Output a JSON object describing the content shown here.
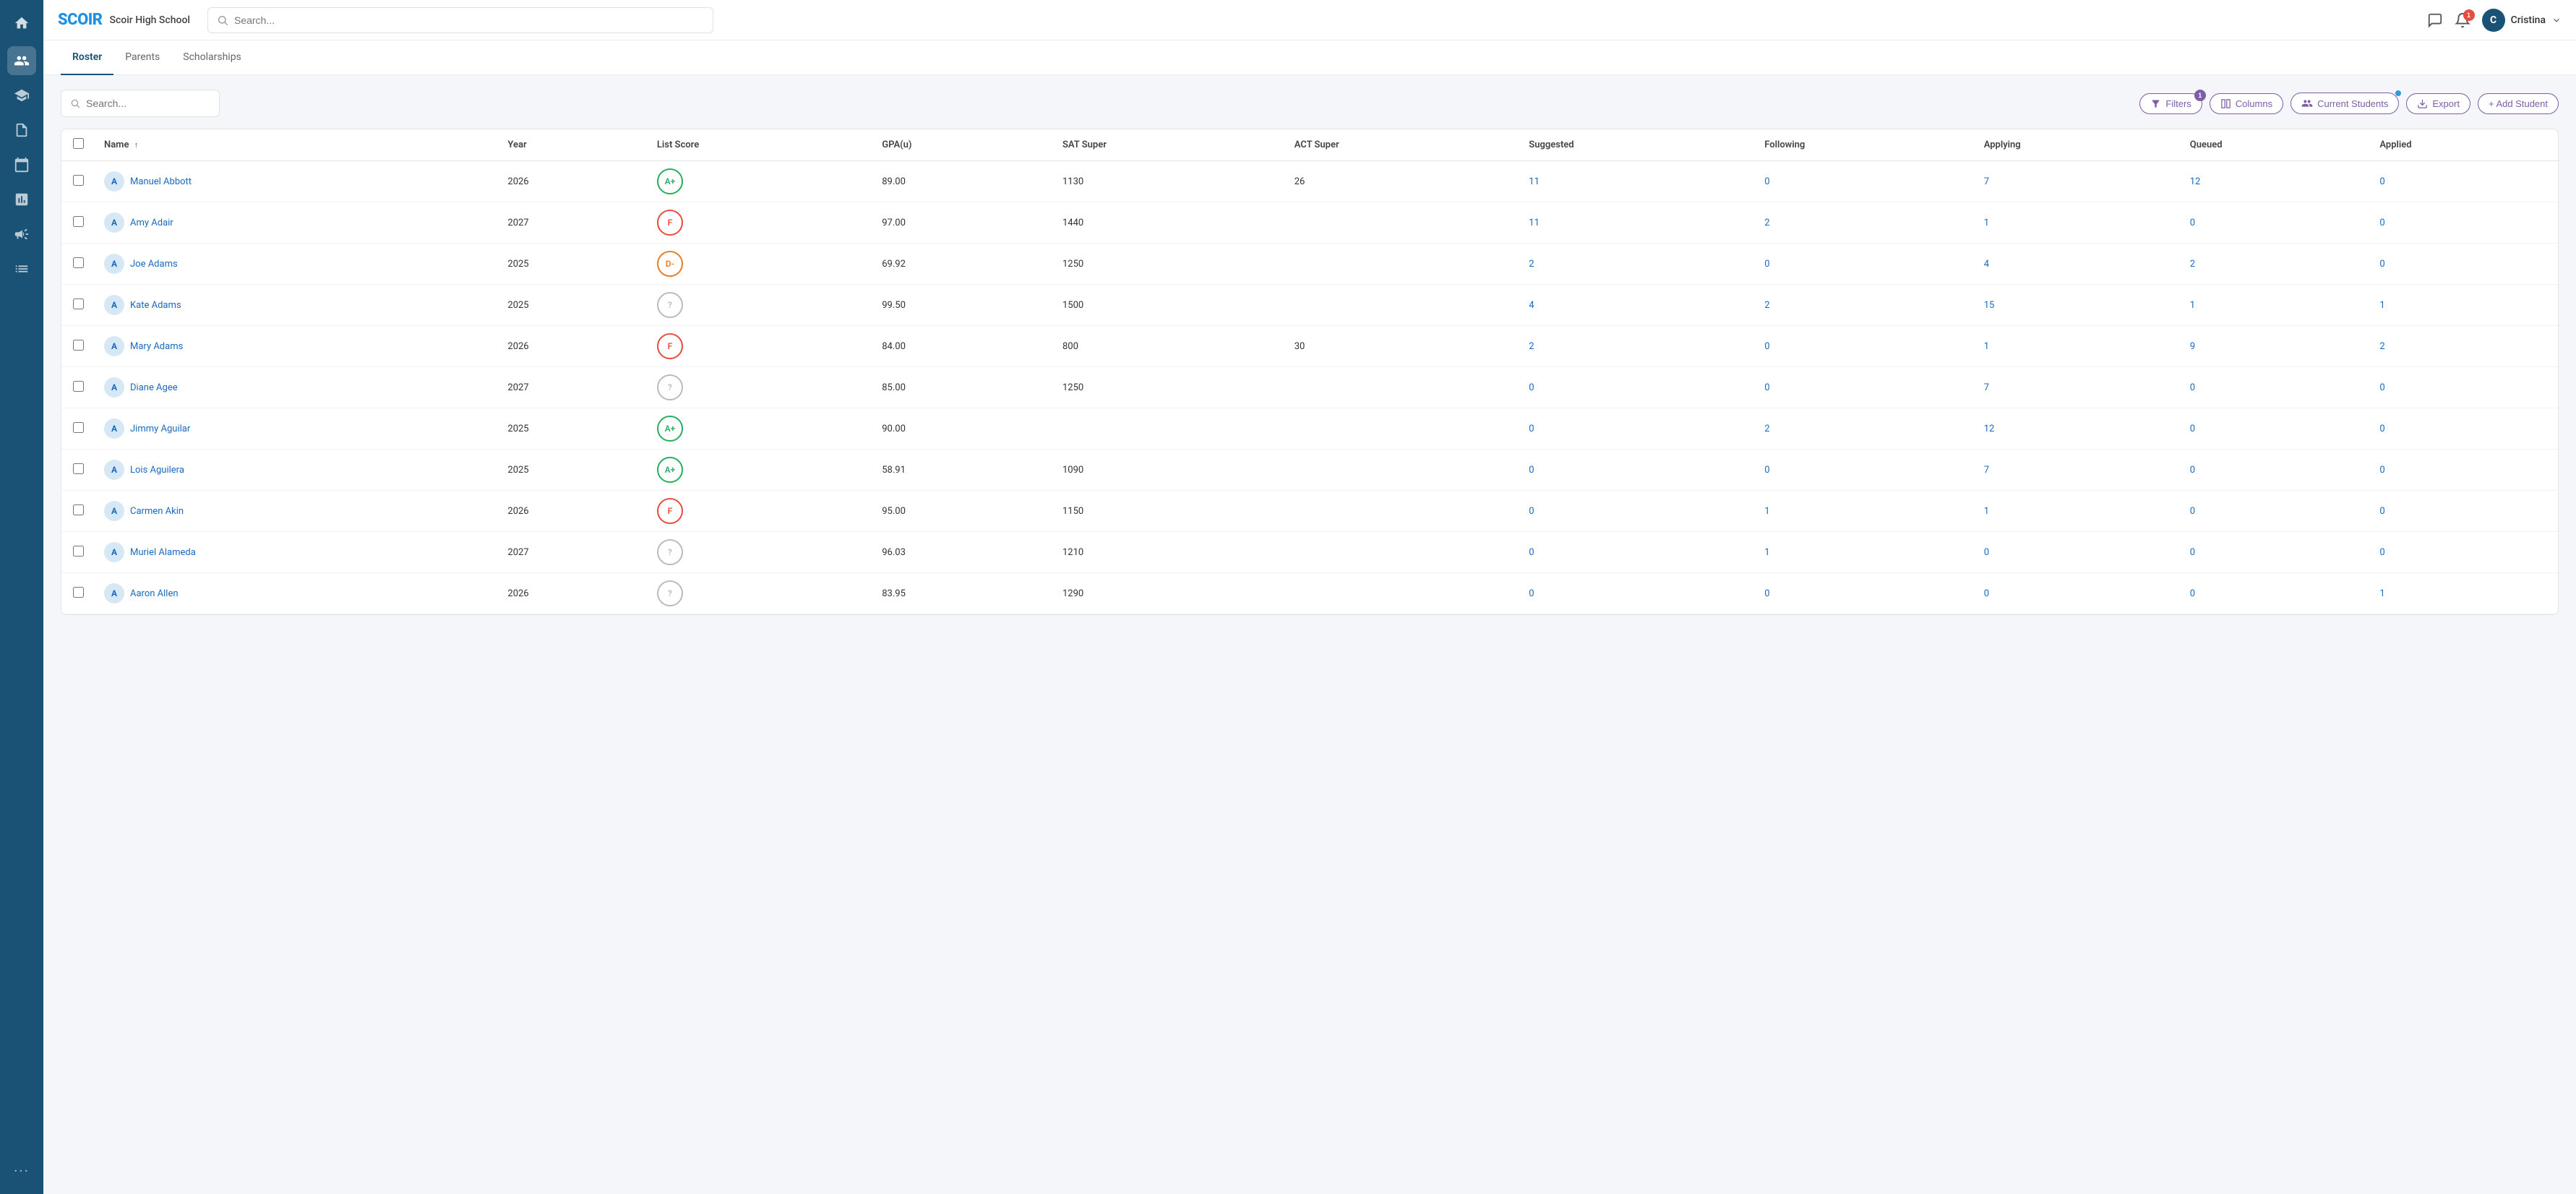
{
  "app": {
    "logo": "SCOIR",
    "school": "Scoir High School"
  },
  "header": {
    "search_placeholder": "Search...",
    "notification_count": "1",
    "user_initial": "C",
    "user_name": "Cristina"
  },
  "tabs": [
    {
      "id": "roster",
      "label": "Roster",
      "active": true
    },
    {
      "id": "parents",
      "label": "Parents",
      "active": false
    },
    {
      "id": "scholarships",
      "label": "Scholarships",
      "active": false
    }
  ],
  "toolbar": {
    "search_placeholder": "Search...",
    "filters_label": "Filters",
    "filters_count": "1",
    "columns_label": "Columns",
    "current_students_label": "Current Students",
    "export_label": "Export",
    "add_student_label": "+ Add Student"
  },
  "table": {
    "columns": [
      {
        "id": "name",
        "label": "Name",
        "sortable": true
      },
      {
        "id": "year",
        "label": "Year"
      },
      {
        "id": "list_score",
        "label": "List Score"
      },
      {
        "id": "gpa",
        "label": "GPA(u)"
      },
      {
        "id": "sat",
        "label": "SAT Super"
      },
      {
        "id": "act",
        "label": "ACT Super"
      },
      {
        "id": "suggested",
        "label": "Suggested"
      },
      {
        "id": "following",
        "label": "Following"
      },
      {
        "id": "applying",
        "label": "Applying"
      },
      {
        "id": "queued",
        "label": "Queued"
      },
      {
        "id": "applied",
        "label": "Applied"
      }
    ],
    "rows": [
      {
        "name": "Manuel Abbott",
        "year": "2026",
        "grade": "A+",
        "grade_class": "grade-a-plus",
        "gpa": "89.00",
        "sat": "1130",
        "act": "26",
        "suggested": "11",
        "following": "0",
        "applying": "7",
        "queued": "12",
        "applied": "0"
      },
      {
        "name": "Amy Adair",
        "year": "2027",
        "grade": "F",
        "grade_class": "grade-f",
        "gpa": "97.00",
        "sat": "1440",
        "act": "",
        "suggested": "11",
        "following": "2",
        "applying": "1",
        "queued": "0",
        "applied": "0"
      },
      {
        "name": "Joe Adams",
        "year": "2025",
        "grade": "D-",
        "grade_class": "grade-d-minus",
        "gpa": "69.92",
        "sat": "1250",
        "act": "",
        "suggested": "2",
        "following": "0",
        "applying": "4",
        "queued": "2",
        "applied": "0"
      },
      {
        "name": "Kate Adams",
        "year": "2025",
        "grade": "?",
        "grade_class": "grade-unknown",
        "gpa": "99.50",
        "sat": "1500",
        "act": "",
        "suggested": "4",
        "following": "2",
        "applying": "15",
        "queued": "1",
        "applied": "1"
      },
      {
        "name": "Mary Adams",
        "year": "2026",
        "grade": "F",
        "grade_class": "grade-f",
        "gpa": "84.00",
        "sat": "800",
        "act": "30",
        "suggested": "2",
        "following": "0",
        "applying": "1",
        "queued": "9",
        "applied": "2"
      },
      {
        "name": "Diane Agee",
        "year": "2027",
        "grade": "?",
        "grade_class": "grade-unknown",
        "gpa": "85.00",
        "sat": "1250",
        "act": "",
        "suggested": "0",
        "following": "0",
        "applying": "7",
        "queued": "0",
        "applied": "0"
      },
      {
        "name": "Jimmy Aguilar",
        "year": "2025",
        "grade": "A+",
        "grade_class": "grade-a-plus",
        "gpa": "90.00",
        "sat": "",
        "act": "",
        "suggested": "0",
        "following": "2",
        "applying": "12",
        "queued": "0",
        "applied": "0"
      },
      {
        "name": "Lois Aguilera",
        "year": "2025",
        "grade": "A+",
        "grade_class": "grade-a-plus",
        "gpa": "58.91",
        "sat": "1090",
        "act": "",
        "suggested": "0",
        "following": "0",
        "applying": "7",
        "queued": "0",
        "applied": "0"
      },
      {
        "name": "Carmen Akin",
        "year": "2026",
        "grade": "F",
        "grade_class": "grade-f",
        "gpa": "95.00",
        "sat": "1150",
        "act": "",
        "suggested": "0",
        "following": "1",
        "applying": "1",
        "queued": "0",
        "applied": "0"
      },
      {
        "name": "Muriel Alameda",
        "year": "2027",
        "grade": "?",
        "grade_class": "grade-unknown",
        "gpa": "96.03",
        "sat": "1210",
        "act": "",
        "suggested": "0",
        "following": "1",
        "applying": "0",
        "queued": "0",
        "applied": "0"
      },
      {
        "name": "Aaron Allen",
        "year": "2026",
        "grade": "?",
        "grade_class": "grade-unknown",
        "gpa": "83.95",
        "sat": "1290",
        "act": "",
        "suggested": "0",
        "following": "0",
        "applying": "0",
        "queued": "0",
        "applied": "1"
      }
    ]
  },
  "sidebar": {
    "items": [
      {
        "id": "home",
        "icon": "⌂",
        "active": false
      },
      {
        "id": "students",
        "icon": "👥",
        "active": true
      },
      {
        "id": "photos",
        "icon": "🎓",
        "active": false
      },
      {
        "id": "document",
        "icon": "📄",
        "active": false
      },
      {
        "id": "calendar",
        "icon": "📅",
        "active": false
      },
      {
        "id": "chart",
        "icon": "📊",
        "active": false
      },
      {
        "id": "megaphone",
        "icon": "📣",
        "active": false
      },
      {
        "id": "list",
        "icon": "☰",
        "active": false
      },
      {
        "id": "more",
        "icon": "•••",
        "active": false
      }
    ]
  }
}
